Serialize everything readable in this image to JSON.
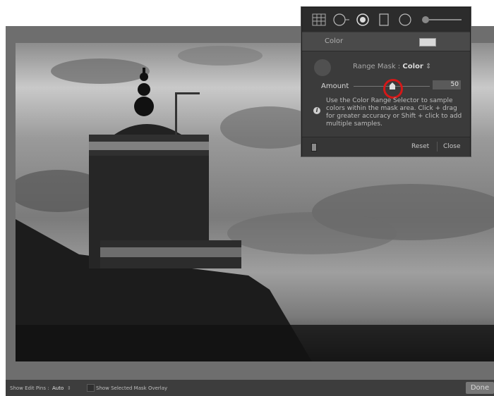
{
  "panel": {
    "color_label": "Color",
    "range_mask_label": "Range Mask :",
    "range_mask_value": "Color",
    "range_mask_arrow": "⇕",
    "amount_label": "Amount",
    "amount_value": "50",
    "amount_fraction": 0.5,
    "help_text": "Use the Color Range Selector to sample colors within the mask area. Click + drag for greater accuracy or Shift + click to add multiple samples.",
    "info_glyph": "i",
    "reset_label": "Reset",
    "close_label": "Close",
    "tools": [
      "graduated-filter-grid-icon",
      "radial-filter-icon",
      "adjustment-brush-icon",
      "crop-icon",
      "spot-removal-icon",
      "slider-icon"
    ]
  },
  "bottom_bar": {
    "edit_pins_label": "Show Edit Pins :",
    "edit_pins_value": "Auto",
    "edit_pins_arrow": "⇕",
    "mask_overlay_label": "Show Selected Mask Overlay",
    "done_label": "Done"
  },
  "colors": {
    "panel_bg": "#3b3b3b",
    "highlight_ring": "#d41818",
    "photo_sky": "#9a9a9a",
    "app_bg": "#6e6e6e"
  }
}
